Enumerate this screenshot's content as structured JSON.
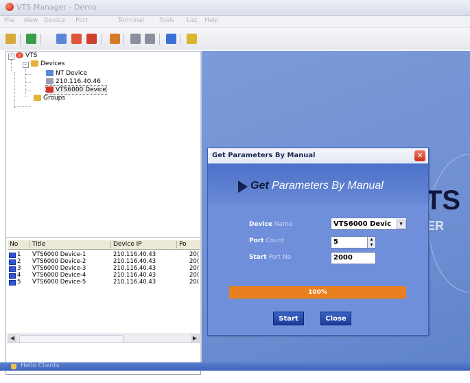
{
  "window": {
    "title": "VTS Manager - Demo"
  },
  "menu": [
    "File",
    "View",
    "Device",
    "Port",
    "Terminal",
    "Tools",
    "List",
    "Help"
  ],
  "toolbar": {
    "icons": [
      "lock-icon",
      "connect-icon",
      "find-icon",
      "save-icon",
      "home-icon",
      "edit-icon",
      "list-icon",
      "grid-icon",
      "window-icon",
      "help-icon"
    ],
    "colors": [
      "#d8a93a",
      "#3a9c4a",
      "#5c84d8",
      "#e0543a",
      "#cf3f2e",
      "#d87a2a",
      "#8a8fa0",
      "#8a8fa0",
      "#3a6fd8",
      "#d8b52a"
    ]
  },
  "tree": {
    "root": "VTS",
    "devices_label": "Devices",
    "nodes": [
      "NT Device",
      "210.116.40.46",
      "VTS6000 Device"
    ],
    "groups_label": "Groups"
  },
  "device_table": {
    "headers": [
      "No",
      "Title",
      "Device IP",
      "Po"
    ],
    "rows": [
      [
        "1",
        "VTS6000 Device-1",
        "210.116.40.43",
        "20("
      ],
      [
        "2",
        "VTS6000 Device-2",
        "210.116.40.43",
        "20("
      ],
      [
        "3",
        "VTS6000 Device-3",
        "210.116.40.43",
        "20("
      ],
      [
        "4",
        "VTS6000 Device-4",
        "210.116.40.43",
        "20("
      ],
      [
        "5",
        "VTS6000 Device-5",
        "210.116.40.43",
        "20("
      ]
    ]
  },
  "background_logo": {
    "text": "TS",
    "subtext": "ER"
  },
  "status": {
    "text": "Hello Clients"
  },
  "dialog": {
    "title": "Get Parameters By Manual",
    "banner_bold": "Get",
    "banner_rest": " Parameters By Manual",
    "device_name_label_bold": "Device",
    "device_name_label_rest": " Name",
    "device_name_value": "VTS6000 Devic",
    "port_count_label_bold": "Port",
    "port_count_label_rest": " Count",
    "port_count_value": "5",
    "start_port_label_bold": "Start",
    "start_port_label_rest": " Port No",
    "start_port_value": "2000",
    "progress_percent": 100,
    "progress_text": "100%",
    "start_button": "Start",
    "close_button": "Close"
  }
}
